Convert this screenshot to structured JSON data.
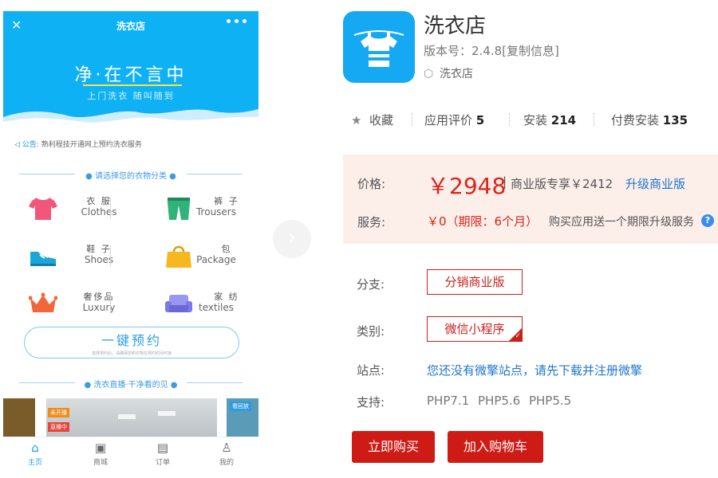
{
  "phone": {
    "header_title": "洗衣店",
    "slogan": "净·在不言中",
    "slogan_sub": "上门洗衣 随叫随到",
    "notice_label": "公告:",
    "notice_text": "熟利程技开通网上预约洗衣服务",
    "category_title": "请选择您的衣物分类",
    "categories": [
      {
        "cn": "衣 服",
        "en": "Clothes",
        "icon": "tshirt-icon",
        "color": "#f2567a"
      },
      {
        "cn": "裤 子",
        "en": "Trousers",
        "icon": "trousers-icon",
        "color": "#2fb37a"
      },
      {
        "cn": "鞋 子",
        "en": "Shoes",
        "icon": "shoe-icon",
        "color": "#1aa6d6"
      },
      {
        "cn": "包",
        "en": "Package",
        "icon": "bag-icon",
        "color": "#f5b820"
      },
      {
        "cn": "奢侈品",
        "en": "Luxury",
        "icon": "crown-icon",
        "color": "#f2673a"
      },
      {
        "cn": "家 纺",
        "en": "textiles",
        "icon": "sofa-icon",
        "color": "#7b78e8"
      }
    ],
    "book_button": "一键预约",
    "book_button_sub": "选择预约后，请确保您和衣物在预约时间可接",
    "live_title": "洗衣直播·干净看的见",
    "live_tags": [
      "未开播",
      "直播中",
      "看回放"
    ],
    "tabs": [
      {
        "label": "主页",
        "icon": "home-icon",
        "active": true
      },
      {
        "label": "商城",
        "icon": "shop-icon",
        "active": false
      },
      {
        "label": "订单",
        "icon": "order-icon",
        "active": false
      },
      {
        "label": "我的",
        "icon": "user-icon",
        "active": false
      }
    ]
  },
  "app": {
    "name": "洗衣店",
    "version": "版本号：2.4.8[复制信息]",
    "tag": "洗衣店",
    "stats": {
      "favorite": "收藏",
      "rating_label": "应用评价",
      "rating": "5",
      "install_label": "安装",
      "install": "214",
      "paid_label": "付费安装",
      "paid": "135"
    },
    "price": {
      "label": "价格:",
      "amount": "￥2948",
      "separator": "|",
      "business": "商业版专享￥2412",
      "upgrade_link": "升级商业版"
    },
    "service": {
      "label": "服务:",
      "value": "￥0（期限：6个月）",
      "note": "购买应用送一个期限升级服务"
    },
    "branch": {
      "label": "分支:",
      "option": "分销商业版"
    },
    "type": {
      "label": "类别:",
      "option": "微信小程序"
    },
    "site": {
      "label": "站点:",
      "link": "您还没有微擎站点，请先下载并注册微擎"
    },
    "support": {
      "label": "支持:",
      "value": "PHP7.1  PHP5.6  PHP5.5"
    },
    "buy_button": "立即购买",
    "cart_button": "加入购物车",
    "accent_color": "#cf1b15",
    "link_color": "#2276cc"
  }
}
